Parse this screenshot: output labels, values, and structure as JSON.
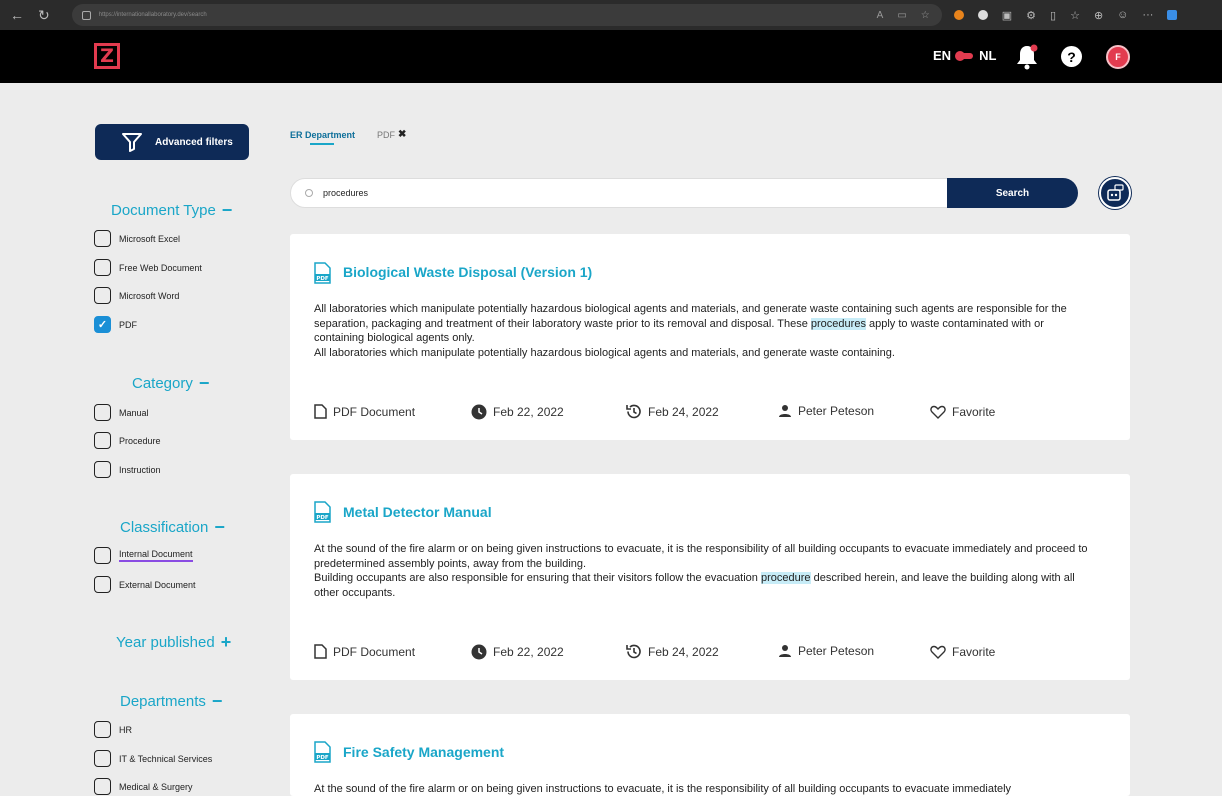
{
  "browser": {
    "url": "https://internationallaboratory.dev/search",
    "icons": [
      "back-icon",
      "refresh-icon",
      "lock-icon",
      "read-aloud-icon",
      "reader-icon",
      "favorite-star-icon",
      "extension-icons",
      "settings-icon"
    ]
  },
  "header": {
    "lang_left": "EN",
    "lang_right": "NL",
    "help": "?",
    "avatar": "F",
    "accent_color": "#e23b4f"
  },
  "sidebar": {
    "advanced_filters": "Advanced filters",
    "sections": {
      "document_type": {
        "title": "Document Type",
        "sign": "−",
        "items": [
          {
            "label": "Microsoft Excel",
            "checked": false
          },
          {
            "label": "Free Web Document",
            "checked": false
          },
          {
            "label": "Microsoft Word",
            "checked": false
          },
          {
            "label": "PDF",
            "checked": true
          }
        ]
      },
      "category": {
        "title": "Category",
        "sign": "−",
        "items": [
          {
            "label": "Manual",
            "checked": false
          },
          {
            "label": "Procedure",
            "checked": false
          },
          {
            "label": "Instruction",
            "checked": false
          }
        ]
      },
      "classification": {
        "title": "Classification",
        "sign": "−",
        "items": [
          {
            "label": "Internal Document",
            "checked": false
          },
          {
            "label": "External Document",
            "checked": false
          }
        ]
      },
      "year_published": {
        "title": "Year published",
        "sign": "+"
      },
      "departments": {
        "title": "Departments",
        "sign": "−",
        "items": [
          {
            "label": "HR",
            "checked": false
          },
          {
            "label": "IT & Technical Services",
            "checked": false
          },
          {
            "label": "Medical & Surgery",
            "checked": false
          }
        ]
      }
    }
  },
  "filters": {
    "active_tab": "ER Department",
    "tab_pdf": "PDF",
    "remove_icon": "✖"
  },
  "search": {
    "value": "procedures",
    "button": "Search"
  },
  "results": [
    {
      "title": "Biological Waste Disposal (Version 1)",
      "body_1": "All laboratories which manipulate potentially hazardous biological agents and materials, and generate waste containing such agents are responsible for the separation, packaging and treatment of their laboratory waste prior to its removal and disposal. These ",
      "highlight": "procedures",
      "body_2": " apply to waste contaminated with or containing biological agents only.",
      "body_3": "All laboratories which manipulate potentially hazardous biological agents and materials, and generate waste containing.",
      "type": "PDF Document",
      "created": "Feb 22, 2022",
      "modified": "Feb 24, 2022",
      "author": "Peter Peteson",
      "favorite": "Favorite"
    },
    {
      "title": "Metal Detector Manual",
      "body_1": "At the sound of the fire alarm or on being given instructions to evacuate, it is the responsibility of all building occupants to evacuate immediately and proceed to predetermined assembly points, away from the building.",
      "body_2a": "Building occupants are also responsible for ensuring that their visitors follow the evacuation ",
      "highlight": "procedure",
      "body_2b": " described herein, and leave the building along with all other occupants.",
      "type": "PDF Document",
      "created": "Feb 22, 2022",
      "modified": "Feb 24, 2022",
      "author": "Peter Peteson",
      "favorite": "Favorite"
    },
    {
      "title": "Fire Safety Management",
      "body_1": "At the sound of the fire alarm or on being given instructions to evacuate, it is the responsibility of all building occupants to evacuate immediately"
    }
  ]
}
